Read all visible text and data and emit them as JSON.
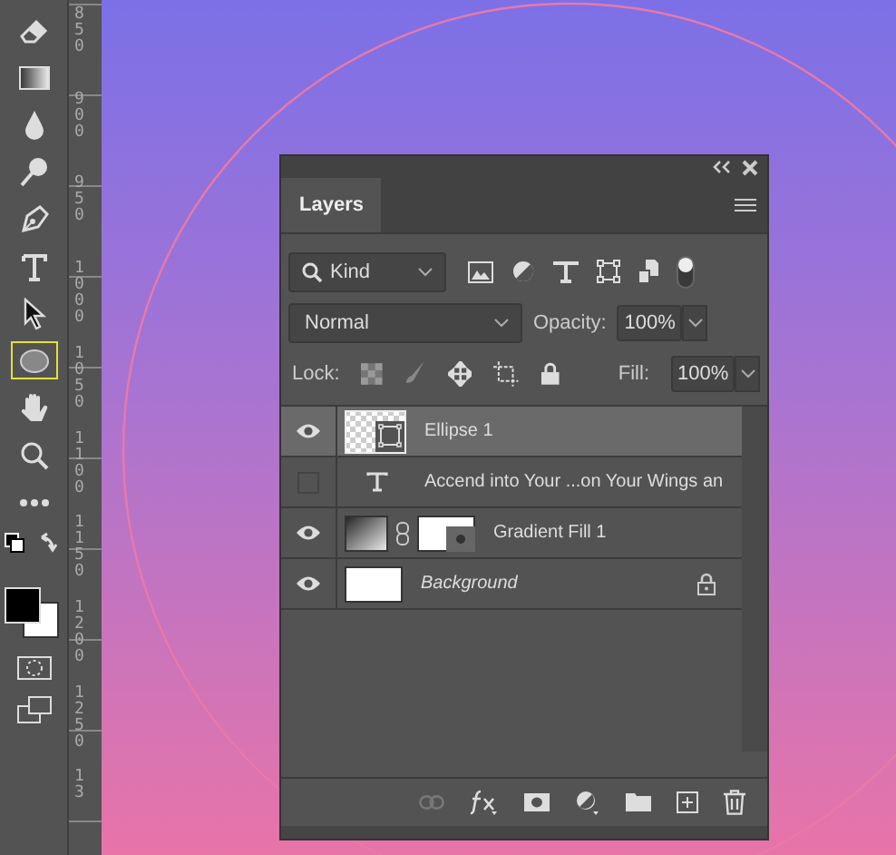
{
  "toolbar": {
    "tools": [
      {
        "kind": "eraser",
        "selected": false
      },
      {
        "kind": "gradient",
        "selected": false
      },
      {
        "kind": "blur",
        "selected": false
      },
      {
        "kind": "dodge",
        "selected": false
      },
      {
        "kind": "pen",
        "selected": false
      },
      {
        "kind": "type",
        "selected": false
      },
      {
        "kind": "select",
        "selected": false
      },
      {
        "kind": "ellipse",
        "selected": true
      },
      {
        "kind": "hand",
        "selected": false
      },
      {
        "kind": "zoom",
        "selected": false
      },
      {
        "kind": "more",
        "selected": false
      }
    ]
  },
  "ruler": {
    "labels": [
      "850",
      "900",
      "950",
      "1000",
      "1050",
      "1100",
      "1150",
      "1200",
      "1250",
      "13"
    ]
  },
  "layers_panel": {
    "tabs": [
      {
        "label": "Layers",
        "selected": true
      }
    ],
    "filter": {
      "value": "Kind"
    },
    "blend_mode": {
      "value": "Normal"
    },
    "opacity": {
      "label": "Opacity:",
      "value": "100%"
    },
    "lock": {
      "label": "Lock:"
    },
    "fill": {
      "label": "Fill:",
      "value": "100%"
    },
    "layers": [
      {
        "name": "Ellipse 1",
        "kind": "shape",
        "visible": true,
        "selected": true,
        "locked": false
      },
      {
        "name": "Accend into Your ...on Your Wings an",
        "kind": "text",
        "visible": false,
        "selected": false,
        "locked": false
      },
      {
        "name": "Gradient Fill 1",
        "kind": "fill",
        "visible": true,
        "selected": false,
        "locked": false
      },
      {
        "name": "Background",
        "kind": "background",
        "visible": true,
        "selected": false,
        "locked": true
      }
    ]
  }
}
